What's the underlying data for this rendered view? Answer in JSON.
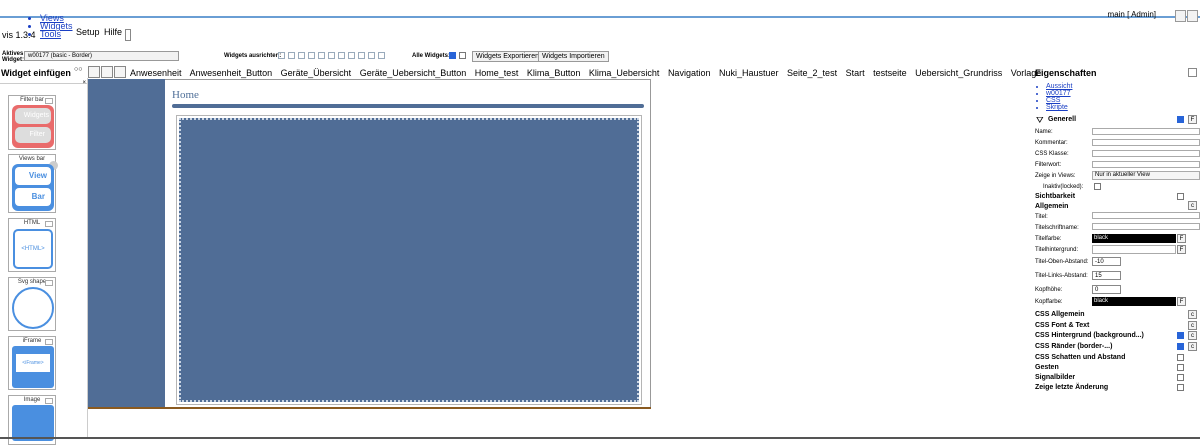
{
  "menu": {
    "items": [
      "Views",
      "Widgets",
      "Tools"
    ],
    "setup": "Setup",
    "help": "Hilfe",
    "version": "vis 1.3.4"
  },
  "header": {
    "user": "main [ Admin]"
  },
  "toolbar": {
    "active_widget_label": "Aktives Widget:",
    "active_widget_value": "w00177 (basic - Border)",
    "align_label": "Widgets ausrichten:",
    "all_widgets_label": "Alle Widgets:",
    "export_btn": "Widgets Exportieren",
    "import_btn": "Widgets Importieren"
  },
  "tabs": [
    "Anwesenheit",
    "Anwesenheit_Button",
    "Geräte_Übersicht",
    "Geräte_Uebersicht_Button",
    "Home_test",
    "Klima_Button",
    "Klima_Uebersicht",
    "Navigation",
    "Nuki_Haustuer",
    "Seite_2_test",
    "Start",
    "testseite",
    "Uebersicht_Grundriss",
    "Vorlage"
  ],
  "left_panel": {
    "title": "Widget einfügen",
    "cards": [
      {
        "title": "Filter bar",
        "line1": "Widgets",
        "line2": "Filter"
      },
      {
        "title": "Views bar",
        "line1": "View",
        "line2": "Bar"
      },
      {
        "title": "HTML",
        "line1": "<HTML>"
      },
      {
        "title": "Svg shape"
      },
      {
        "title": "iFrame",
        "line1": "<iFrame>"
      },
      {
        "title": "Image"
      }
    ]
  },
  "canvas": {
    "title": "Home"
  },
  "right_panel": {
    "title": "Eigenschaften",
    "links": [
      "Aussicht",
      "w00177",
      "CSS",
      "Skripte"
    ],
    "general": "Generell",
    "fields": {
      "name": "Name:",
      "comment": "Kommentar:",
      "css_class": "CSS Klasse:",
      "filter": "Filterwort:",
      "views": "Zeige in Views:",
      "views_value": "Nur in aktueller View",
      "locked": "Inaktiv(locked):"
    },
    "visibility": "Sichtbarkeit",
    "common": "Allgemein",
    "common_fields": {
      "title": "Titel:",
      "title_font": "Titelschriftname:",
      "title_color": "Titelfarbe:",
      "title_color_value": "black",
      "title_bg": "Titelhintergrund:",
      "title_top": "Titel-Oben-Abstand:",
      "title_top_value": "-10",
      "title_left": "Titel-Links-Abstand:",
      "title_left_value": "15",
      "header_height": "Kopfhöhe:",
      "header_height_value": "0",
      "header_color": "Kopffarbe:",
      "header_color_value": "black"
    },
    "sections": [
      "CSS Allgemein",
      "CSS Font & Text",
      "CSS Hintergrund (background...)",
      "CSS Ränder (border-...)",
      "CSS Schatten und Abstand",
      "Gesten",
      "Signalbilder",
      "Zeige letzte Änderung"
    ]
  }
}
